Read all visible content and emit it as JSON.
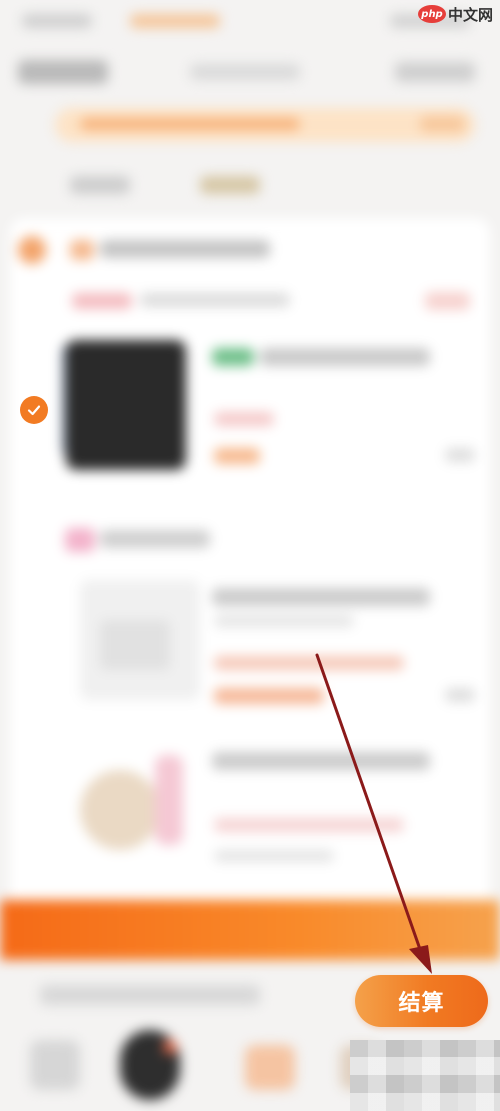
{
  "watermark": {
    "logo": "php",
    "text": "中文网"
  },
  "bottom_bar": {
    "checkout_label": "结算"
  },
  "icons": {
    "item_select": "check-icon",
    "annotation": "arrow-icon"
  },
  "colors": {
    "accent": "#f27b23",
    "banner": "#f98a2a",
    "arrow": "#8b1a1a"
  }
}
